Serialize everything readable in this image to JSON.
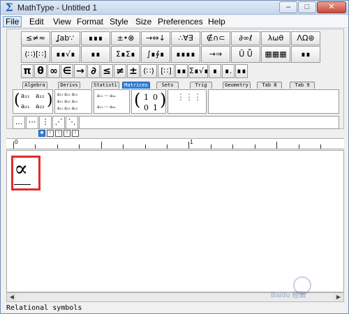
{
  "window": {
    "title": "MathType - Untitled 1",
    "app_icon": "Σ",
    "minimize_glyph": "–",
    "maximize_glyph": "□",
    "close_glyph": "✕"
  },
  "menu": {
    "items": [
      "File",
      "Edit",
      "View",
      "Format",
      "Style",
      "Size",
      "Preferences",
      "Help"
    ]
  },
  "palette_row1": [
    "≤≠≈",
    "ʆab∵",
    "∎∎∎",
    "±•⊗",
    "→⇔↓",
    "∴∀∃",
    "∉∩⊂",
    "∂∞ℓ",
    "λωθ",
    "ΛΩ⊛"
  ],
  "palette_row2": [
    "(∷)[∷]",
    "∎∎√∎",
    "∎∎",
    "Σ∎Σ∎",
    "∫∎∮∎",
    "∎∎∎∎",
    "→⇒",
    "Ū Ṻ",
    "▦▦▦",
    "∎∎"
  ],
  "small_symbols": [
    "π",
    "θ",
    "∞",
    "∈",
    "→",
    "∂",
    "≤",
    "≠",
    "±",
    "(∷)",
    "[∷]",
    "∎∎",
    "Σ∎√∎",
    "∎",
    "∎.",
    "∎∎"
  ],
  "tabs": [
    "Algebra",
    "Derivs",
    "Statisti",
    "Matrices",
    "Sets",
    "Trig",
    "Geometry",
    "Tab 8",
    "Tab 9"
  ],
  "active_tab": "Matrices",
  "matrix_templates": {
    "m2x2_var": [
      "a₁₁",
      "a₁₂",
      "a₂₁",
      "a₂₂"
    ],
    "m3x3_var": "a₁₁ a₁₂ a₁₃",
    "mNxN_var": "a₁₁ ⋯ a₁ₙ",
    "identity": [
      "1",
      "0",
      "0",
      "1"
    ],
    "dotted": "⋮"
  },
  "dots_row": [
    "…",
    "⋯",
    "⋮",
    "⋰",
    "⋱"
  ],
  "size_buttons": [
    "■",
    "↑",
    "↑",
    "↑",
    "↑"
  ],
  "ruler": {
    "labels": [
      "0",
      "1"
    ]
  },
  "editor": {
    "equation": "∝"
  },
  "status_text": "Relational symbols",
  "watermark": {
    "text": "Baidu 经验"
  },
  "colors": {
    "accent": "#2f7fd7",
    "highlight": "#e22a2a"
  }
}
